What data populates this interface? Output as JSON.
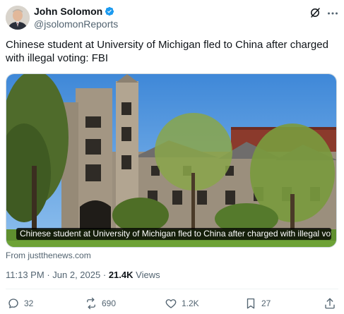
{
  "author": {
    "display_name": "John Solomon",
    "handle": "@jsolomonReports",
    "verified": true,
    "verified_color": "#1d9bf0"
  },
  "tweet": {
    "text": "Chinese student at University of Michigan fled to China after charged with illegal voting: FBI"
  },
  "media": {
    "caption": "Chinese student at University of Michigan fled to China after charged with illegal votin...",
    "source": "From justthenews.com"
  },
  "meta": {
    "time": "11:13 PM",
    "separator": "·",
    "date": "Jun 2, 2025",
    "views_count": "21.4K",
    "views_label": "Views"
  },
  "actions": {
    "replies": "32",
    "reposts": "690",
    "likes": "1.2K",
    "bookmarks": "27"
  },
  "icons": [
    "verified-badge-icon",
    "grok-icon",
    "more-icon",
    "reply-icon",
    "repost-icon",
    "like-icon",
    "bookmark-icon",
    "share-icon"
  ],
  "colors": {
    "text_primary": "#0f1419",
    "text_secondary": "#536471",
    "border": "#cfd9de"
  }
}
